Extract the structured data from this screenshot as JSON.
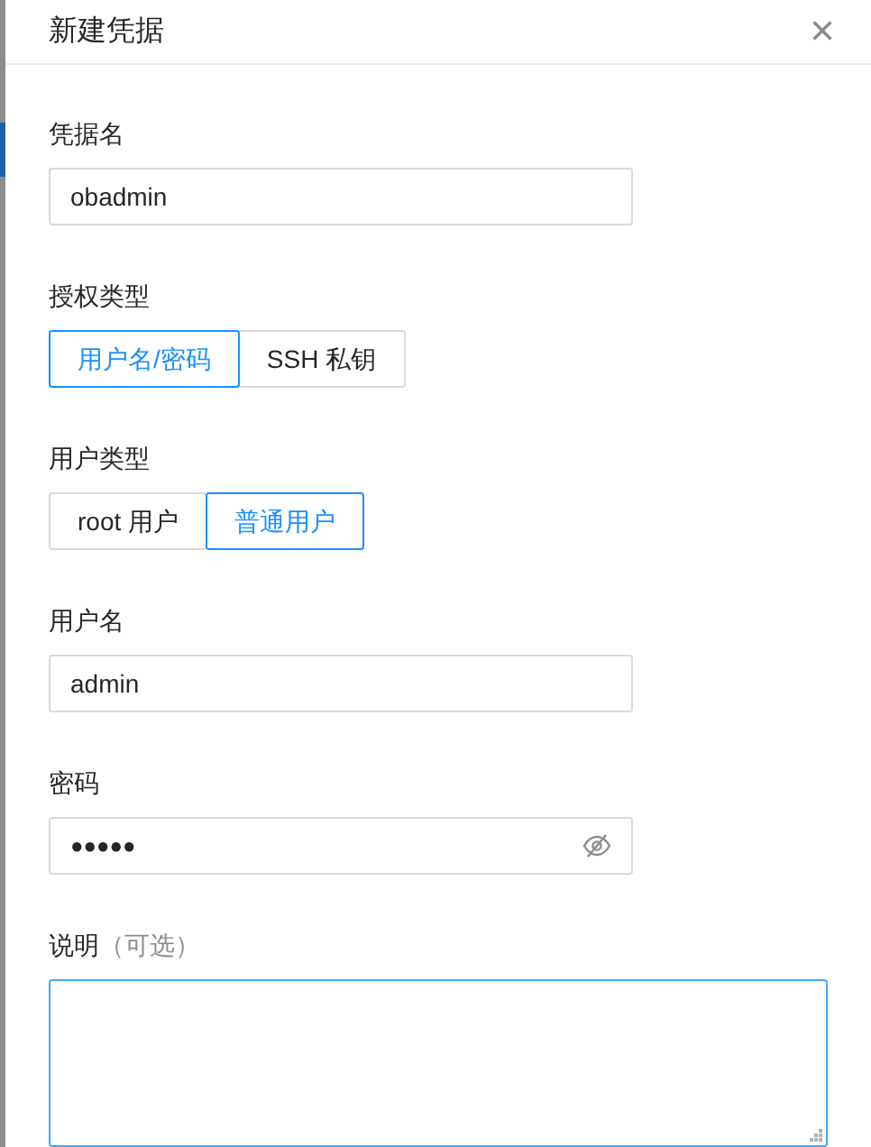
{
  "dialog": {
    "title": "新建凭据",
    "close": "×"
  },
  "fields": [
    {
      "kind": "text",
      "label": "凭据名",
      "value": "obadmin"
    },
    {
      "kind": "segmented",
      "label": "授权类型",
      "options": [
        {
          "label": "用户名/密码",
          "selected": true
        },
        {
          "label": "SSH 私钥",
          "selected": false
        }
      ]
    },
    {
      "kind": "segmented",
      "label": "用户类型",
      "options": [
        {
          "label": "root 用户",
          "selected": false
        },
        {
          "label": "普通用户",
          "selected": true
        }
      ]
    },
    {
      "kind": "text",
      "label": "用户名",
      "value": "admin"
    },
    {
      "kind": "password",
      "label": "密码",
      "value": "●●●●●"
    },
    {
      "kind": "textarea",
      "label": "说明",
      "hint": "（可选）",
      "focused": true
    }
  ]
}
